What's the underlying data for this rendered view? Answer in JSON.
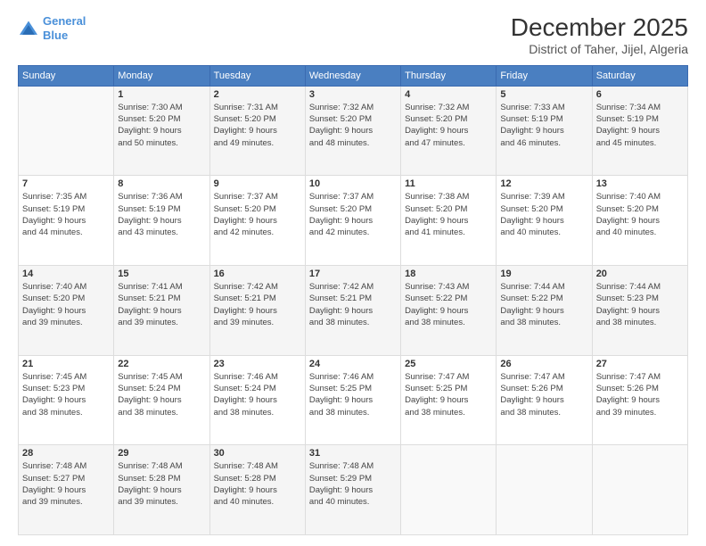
{
  "logo": {
    "line1": "General",
    "line2": "Blue"
  },
  "title": "December 2025",
  "subtitle": "District of Taher, Jijel, Algeria",
  "days_of_week": [
    "Sunday",
    "Monday",
    "Tuesday",
    "Wednesday",
    "Thursday",
    "Friday",
    "Saturday"
  ],
  "weeks": [
    [
      {
        "day": "",
        "info": ""
      },
      {
        "day": "1",
        "info": "Sunrise: 7:30 AM\nSunset: 5:20 PM\nDaylight: 9 hours\nand 50 minutes."
      },
      {
        "day": "2",
        "info": "Sunrise: 7:31 AM\nSunset: 5:20 PM\nDaylight: 9 hours\nand 49 minutes."
      },
      {
        "day": "3",
        "info": "Sunrise: 7:32 AM\nSunset: 5:20 PM\nDaylight: 9 hours\nand 48 minutes."
      },
      {
        "day": "4",
        "info": "Sunrise: 7:32 AM\nSunset: 5:20 PM\nDaylight: 9 hours\nand 47 minutes."
      },
      {
        "day": "5",
        "info": "Sunrise: 7:33 AM\nSunset: 5:19 PM\nDaylight: 9 hours\nand 46 minutes."
      },
      {
        "day": "6",
        "info": "Sunrise: 7:34 AM\nSunset: 5:19 PM\nDaylight: 9 hours\nand 45 minutes."
      }
    ],
    [
      {
        "day": "7",
        "info": "Sunrise: 7:35 AM\nSunset: 5:19 PM\nDaylight: 9 hours\nand 44 minutes."
      },
      {
        "day": "8",
        "info": "Sunrise: 7:36 AM\nSunset: 5:19 PM\nDaylight: 9 hours\nand 43 minutes."
      },
      {
        "day": "9",
        "info": "Sunrise: 7:37 AM\nSunset: 5:20 PM\nDaylight: 9 hours\nand 42 minutes."
      },
      {
        "day": "10",
        "info": "Sunrise: 7:37 AM\nSunset: 5:20 PM\nDaylight: 9 hours\nand 42 minutes."
      },
      {
        "day": "11",
        "info": "Sunrise: 7:38 AM\nSunset: 5:20 PM\nDaylight: 9 hours\nand 41 minutes."
      },
      {
        "day": "12",
        "info": "Sunrise: 7:39 AM\nSunset: 5:20 PM\nDaylight: 9 hours\nand 40 minutes."
      },
      {
        "day": "13",
        "info": "Sunrise: 7:40 AM\nSunset: 5:20 PM\nDaylight: 9 hours\nand 40 minutes."
      }
    ],
    [
      {
        "day": "14",
        "info": "Sunrise: 7:40 AM\nSunset: 5:20 PM\nDaylight: 9 hours\nand 39 minutes."
      },
      {
        "day": "15",
        "info": "Sunrise: 7:41 AM\nSunset: 5:21 PM\nDaylight: 9 hours\nand 39 minutes."
      },
      {
        "day": "16",
        "info": "Sunrise: 7:42 AM\nSunset: 5:21 PM\nDaylight: 9 hours\nand 39 minutes."
      },
      {
        "day": "17",
        "info": "Sunrise: 7:42 AM\nSunset: 5:21 PM\nDaylight: 9 hours\nand 38 minutes."
      },
      {
        "day": "18",
        "info": "Sunrise: 7:43 AM\nSunset: 5:22 PM\nDaylight: 9 hours\nand 38 minutes."
      },
      {
        "day": "19",
        "info": "Sunrise: 7:44 AM\nSunset: 5:22 PM\nDaylight: 9 hours\nand 38 minutes."
      },
      {
        "day": "20",
        "info": "Sunrise: 7:44 AM\nSunset: 5:23 PM\nDaylight: 9 hours\nand 38 minutes."
      }
    ],
    [
      {
        "day": "21",
        "info": "Sunrise: 7:45 AM\nSunset: 5:23 PM\nDaylight: 9 hours\nand 38 minutes."
      },
      {
        "day": "22",
        "info": "Sunrise: 7:45 AM\nSunset: 5:24 PM\nDaylight: 9 hours\nand 38 minutes."
      },
      {
        "day": "23",
        "info": "Sunrise: 7:46 AM\nSunset: 5:24 PM\nDaylight: 9 hours\nand 38 minutes."
      },
      {
        "day": "24",
        "info": "Sunrise: 7:46 AM\nSunset: 5:25 PM\nDaylight: 9 hours\nand 38 minutes."
      },
      {
        "day": "25",
        "info": "Sunrise: 7:47 AM\nSunset: 5:25 PM\nDaylight: 9 hours\nand 38 minutes."
      },
      {
        "day": "26",
        "info": "Sunrise: 7:47 AM\nSunset: 5:26 PM\nDaylight: 9 hours\nand 38 minutes."
      },
      {
        "day": "27",
        "info": "Sunrise: 7:47 AM\nSunset: 5:26 PM\nDaylight: 9 hours\nand 39 minutes."
      }
    ],
    [
      {
        "day": "28",
        "info": "Sunrise: 7:48 AM\nSunset: 5:27 PM\nDaylight: 9 hours\nand 39 minutes."
      },
      {
        "day": "29",
        "info": "Sunrise: 7:48 AM\nSunset: 5:28 PM\nDaylight: 9 hours\nand 39 minutes."
      },
      {
        "day": "30",
        "info": "Sunrise: 7:48 AM\nSunset: 5:28 PM\nDaylight: 9 hours\nand 40 minutes."
      },
      {
        "day": "31",
        "info": "Sunrise: 7:48 AM\nSunset: 5:29 PM\nDaylight: 9 hours\nand 40 minutes."
      },
      {
        "day": "",
        "info": ""
      },
      {
        "day": "",
        "info": ""
      },
      {
        "day": "",
        "info": ""
      }
    ]
  ]
}
